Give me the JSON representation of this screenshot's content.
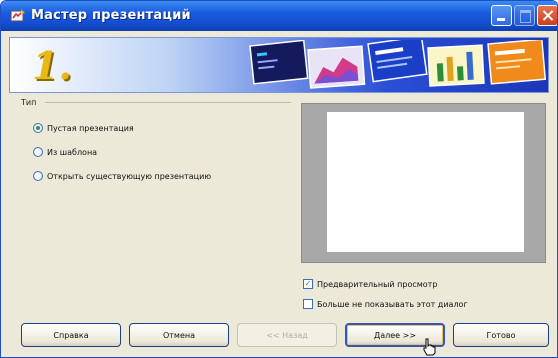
{
  "window": {
    "title": "Мастер презентаций",
    "accent_color": "#1550d3"
  },
  "banner": {
    "step_label": "1.",
    "slide_thumbnails": [
      "slide-dark-blue-icon",
      "slide-area-chart-icon",
      "slide-blue-text-icon",
      "slide-bar-chart-icon",
      "slide-orange-icon"
    ]
  },
  "type_group": {
    "label": "Тип",
    "options": [
      {
        "label": "Пустая презентация",
        "selected": true
      },
      {
        "label": "Из шаблона",
        "selected": false
      },
      {
        "label": "Открыть существующую презентацию",
        "selected": false
      }
    ]
  },
  "preview_area": {
    "checkboxes": [
      {
        "label": "Предварительный просмотр",
        "checked": true
      },
      {
        "label": "Больше не показывать этот диалог",
        "checked": false
      }
    ]
  },
  "buttons": {
    "help": "Справка",
    "cancel": "Отмена",
    "back": "<< Назад",
    "next": "Далее >>",
    "done": "Готово"
  }
}
